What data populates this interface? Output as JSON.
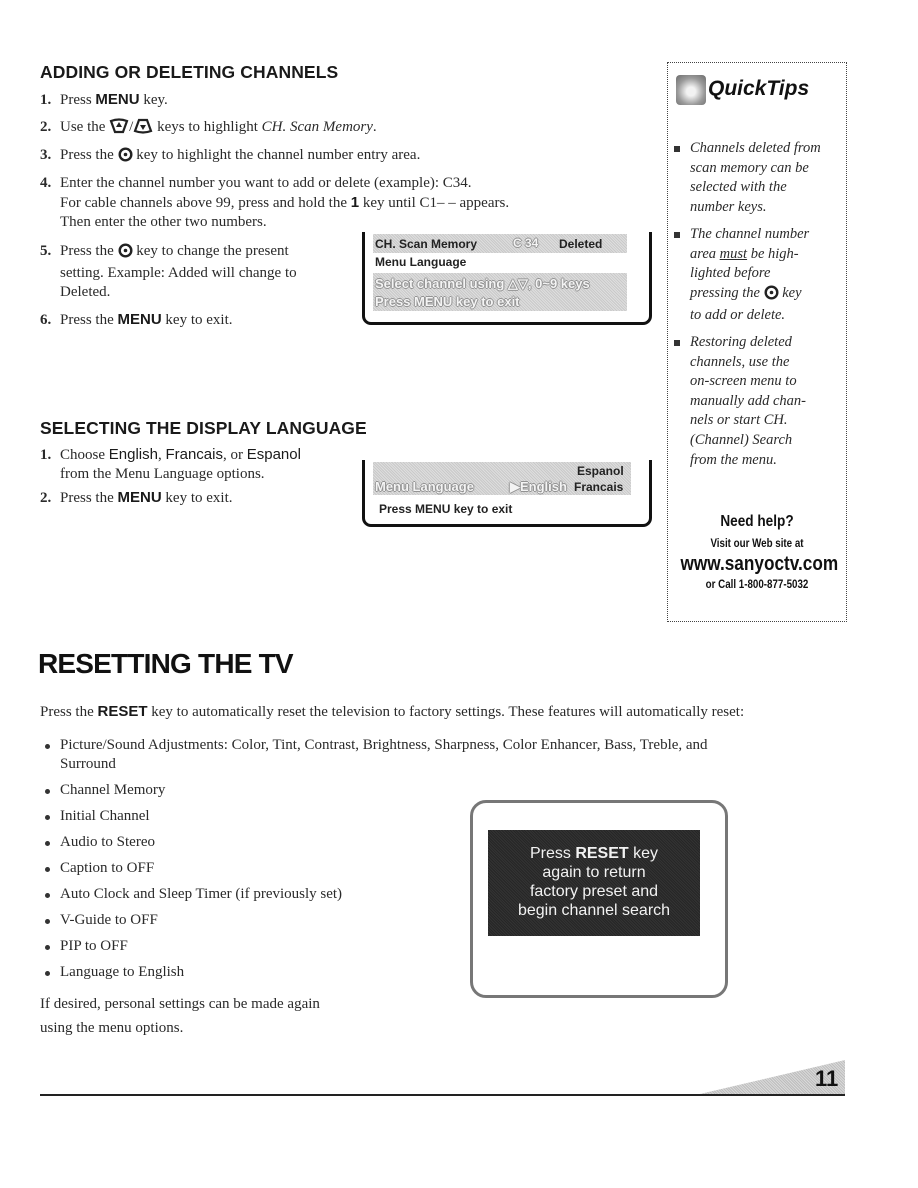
{
  "adding": {
    "heading": "ADDING OR DELETING CHANNELS",
    "steps": [
      {
        "num": "1.",
        "pre": "Press ",
        "key": "MENU",
        "post": " key."
      },
      {
        "num": "2.",
        "pre": "Use the ",
        "mid": " keys to highlight ",
        "italic": "CH. Scan Memory",
        "post": "."
      },
      {
        "num": "3.",
        "pre": "Press the ",
        "post": " key to highlight the channel number entry area."
      },
      {
        "num": "4.",
        "line1": "Enter the channel number you want to add or delete (example):  C34.",
        "line2_pre": "For cable channels above 99, press and hold the ",
        "line2_key": "1",
        "line2_post": " key until C1– – appears.",
        "line3": "Then enter the other two numbers."
      },
      {
        "num": "5.",
        "pre": "Press the ",
        "post": " key to change the present",
        "line2": "setting.  Example: Added will change to",
        "line3": "Deleted."
      },
      {
        "num": "6.",
        "pre": "Press the ",
        "key": "MENU",
        "post": " key to exit."
      }
    ],
    "osd": {
      "row1_label": "CH. Scan Memory",
      "row1_channel": "C 34",
      "row1_status": "Deleted",
      "row2_label": "Menu Language",
      "hint1": "Select channel using △▽, 0~9 keys",
      "hint2": "Press MENU key to exit"
    }
  },
  "language": {
    "heading": "SELECTING THE DISPLAY LANGUAGE",
    "steps": [
      {
        "num": "1.",
        "pre": "Choose ",
        "opt1": "English",
        "sep1": ", ",
        "opt2": "Francais",
        "sep2": ", or ",
        "opt3": "Espanol",
        "line2": "from the Menu Language options."
      },
      {
        "num": "2.",
        "pre": "Press the ",
        "key": "MENU",
        "post": " key to exit."
      }
    ],
    "osd": {
      "label": "Menu Language",
      "selected": "▶English",
      "option_top": "Espanol",
      "option_bottom": "Francais",
      "footer": "Press MENU key to exit"
    }
  },
  "quicktips": {
    "title": "QuickTips",
    "tips": [
      {
        "lines": [
          "Channels deleted from",
          "scan memory can be",
          "selected with the",
          "number keys."
        ]
      },
      {
        "lines_pre": "The channel number",
        "line2_pre": "area ",
        "line2_u": "must",
        "line2_post": " be high-",
        "line3": "lighted before",
        "line4_pre": "pressing the ",
        "line4_post": " key",
        "line5": "to add or delete."
      },
      {
        "lines": [
          "Restoring deleted",
          "channels, use the",
          "on-screen menu to",
          "manually add chan-",
          "nels or start CH.",
          "(Channel) Search",
          "from the menu."
        ]
      }
    ],
    "help": {
      "title": "Need help?",
      "visit": "Visit our Web site at",
      "url": "www.sanyoctv.com",
      "call": "or Call 1-800-877-5032"
    }
  },
  "reset": {
    "heading": "RESETTING THE TV",
    "intro_pre": "Press the ",
    "intro_key": "RESET",
    "intro_post": " key to automatically reset the television to factory settings. These features will automatically reset:",
    "items": [
      "Picture/Sound Adjustments: Color, Tint, Contrast, Brightness, Sharpness, Color Enhancer, Bass, Treble, and",
      "Channel Memory",
      "Initial Channel",
      "Audio to Stereo",
      "Caption to OFF",
      "Auto Clock and Sleep Timer  (if previously set)",
      "V-Guide to OFF",
      "PIP to OFF",
      "Language to English"
    ],
    "item0_cont": "Surround",
    "outro1": "If desired, personal settings can be made again",
    "outro2": "using the menu options.",
    "screen": {
      "line1_pre": "Press ",
      "line1_key": "RESET",
      "line1_post": " key",
      "line2": "again to return",
      "line3": "factory preset and",
      "line4": "begin channel search"
    }
  },
  "footer": {
    "page_number": "11"
  }
}
